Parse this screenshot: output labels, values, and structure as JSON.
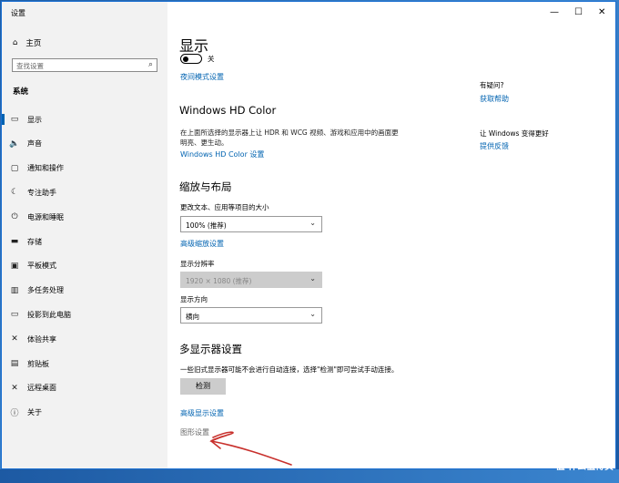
{
  "window": {
    "title": "设置",
    "min": "—",
    "max": "☐",
    "close": "✕"
  },
  "sidebar": {
    "home": "主页",
    "search_placeholder": "查找设置",
    "section": "系统",
    "items": [
      {
        "label": "显示",
        "icon": "▭"
      },
      {
        "label": "声音",
        "icon": "🔈"
      },
      {
        "label": "通知和操作",
        "icon": "▢"
      },
      {
        "label": "专注助手",
        "icon": "☾"
      },
      {
        "label": "电源和睡眠",
        "icon": "⏻"
      },
      {
        "label": "存储",
        "icon": "▬"
      },
      {
        "label": "平板模式",
        "icon": "▣"
      },
      {
        "label": "多任务处理",
        "icon": "▥"
      },
      {
        "label": "投影到此电脑",
        "icon": "▭"
      },
      {
        "label": "体验共享",
        "icon": "✕"
      },
      {
        "label": "剪贴板",
        "icon": "▤"
      },
      {
        "label": "远程桌面",
        "icon": "✕"
      },
      {
        "label": "关于",
        "icon": "ⓘ"
      }
    ]
  },
  "main": {
    "title": "显示",
    "toggle_state": "关",
    "night_link": "夜间模式设置",
    "hdr_heading": "Windows HD Color",
    "hdr_desc_1": "在上面所选择的显示器上让 HDR 和 WCG 视频、游戏和应用中的画面更",
    "hdr_desc_2": "明亮、更生动。",
    "hdr_link": "Windows HD Color 设置",
    "scale_heading": "缩放与布局",
    "scale_label": "更改文本、应用等项目的大小",
    "scale_value": "100% (推荐)",
    "adv_scale_link": "高级缩放设置",
    "res_label": "显示分辨率",
    "res_value": "1920 × 1080 (推荐)",
    "orient_label": "显示方向",
    "orient_value": "横向",
    "multi_heading": "多显示器设置",
    "multi_desc": "一些旧式显示器可能不会进行自动连接，选择\"检测\"即可尝试手动连接。",
    "detect_button": "检测",
    "adv_display_link": "高级显示设置",
    "graphics_link": "图形设置"
  },
  "right": {
    "q_heading": "有疑问?",
    "q_link": "获取帮助",
    "fb_heading": "让 Windows 变得更好",
    "fb_link": "提供反馈"
  },
  "watermark": "值 什么值得买",
  "colors": {
    "accent": "#0063b1",
    "annotation": "#c8302c"
  }
}
